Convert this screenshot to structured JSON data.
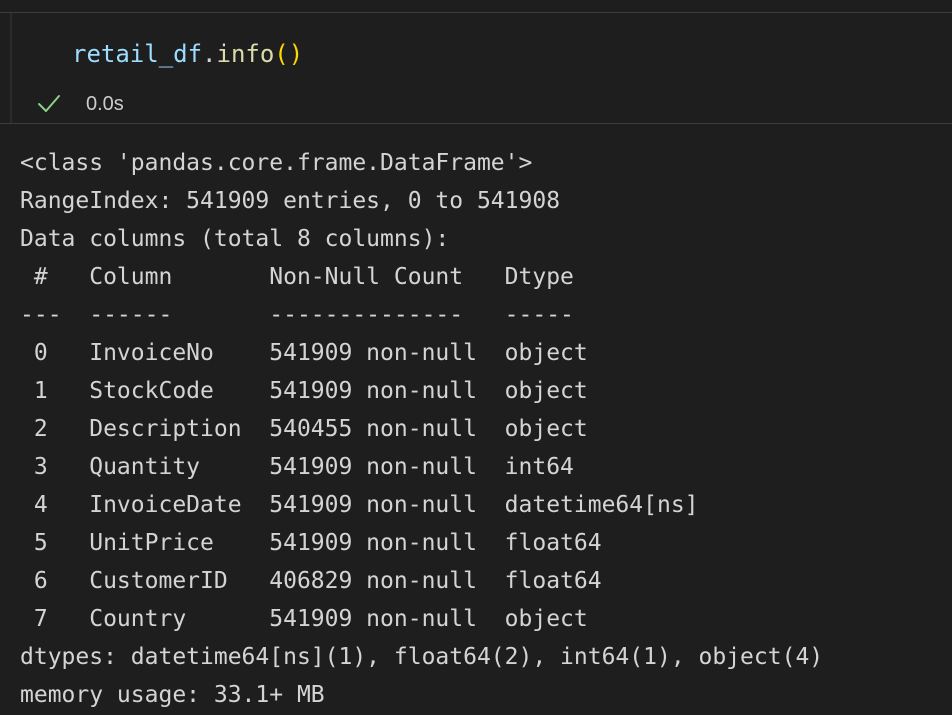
{
  "cell": {
    "code": {
      "variable": "retail_df",
      "dot": ".",
      "method": "info",
      "paren_open": "(",
      "paren_close": ")"
    },
    "status": {
      "icon": "check-icon",
      "time": "0.0s",
      "icon_color": "#89d185"
    }
  },
  "output": {
    "lines": [
      "<class 'pandas.core.frame.DataFrame'>",
      "RangeIndex: 541909 entries, 0 to 541908",
      "Data columns (total 8 columns):",
      " #   Column       Non-Null Count   Dtype         ",
      "---  ------       --------------   -----         ",
      " 0   InvoiceNo    541909 non-null  object        ",
      " 1   StockCode    541909 non-null  object        ",
      " 2   Description  540455 non-null  object        ",
      " 3   Quantity     541909 non-null  int64         ",
      " 4   InvoiceDate  541909 non-null  datetime64[ns]",
      " 5   UnitPrice    541909 non-null  float64       ",
      " 6   CustomerID   406829 non-null  float64       ",
      " 7   Country      541909 non-null  object        ",
      "dtypes: datetime64[ns](1), float64(2), int64(1), object(4)",
      "memory usage: 33.1+ MB"
    ]
  },
  "colors": {
    "background": "#1e1e1e",
    "variable": "#9cdcfe",
    "function": "#dcdcaa",
    "bracket": "#ffd700",
    "output_text": "#d4d4d4"
  }
}
